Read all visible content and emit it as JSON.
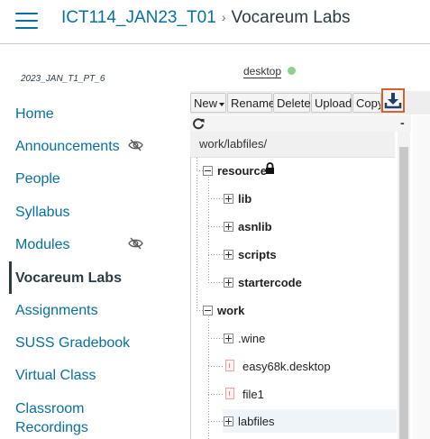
{
  "header": {
    "course": "ICT114_JAN23_T01",
    "separator": "›",
    "current": "Vocareum Labs"
  },
  "sidebar": {
    "term": "2023_JAN_T1_PT_6",
    "items": [
      {
        "label": "Home"
      },
      {
        "label": "Announcements",
        "hidden_icon": "eye-slash-icon"
      },
      {
        "label": "People"
      },
      {
        "label": "Syllabus"
      },
      {
        "label": "Modules",
        "hidden_icon": "eye-slash-icon"
      },
      {
        "label": "Vocareum Labs",
        "active": true
      },
      {
        "label": "Assignments"
      },
      {
        "label": "SUSS Gradebook"
      },
      {
        "label": "Virtual Class"
      },
      {
        "label": "Classroom",
        "label2": "Recordings"
      }
    ]
  },
  "lab": {
    "tab_label": "desktop",
    "status_color": "#8fd18f",
    "toolbar": {
      "new": "New",
      "rename": "Rename",
      "delete": "Delete",
      "upload": "Upload",
      "copy": "Copy",
      "download_icon": "download-icon"
    },
    "minimize": "-",
    "path": "work/labfiles/",
    "tree": {
      "resource": "resource",
      "lib": "lib",
      "asnlib": "asnlib",
      "scripts": "scripts",
      "startercode": "startercode",
      "work": "work",
      "wine": ".wine",
      "desktop_file": "easy68k.desktop",
      "file1": "file1",
      "labfiles": "labfiles"
    },
    "accent_color": "#d0642d"
  }
}
